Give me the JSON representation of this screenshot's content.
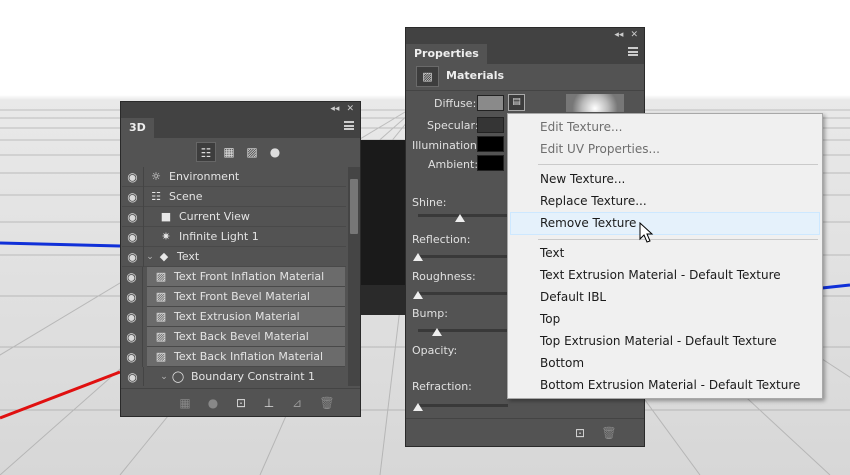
{
  "panel3d": {
    "tab": "3D",
    "layers": [
      {
        "label": "Environment",
        "icon": "environment-icon",
        "glyph": "☼",
        "depth": 0,
        "selected": false
      },
      {
        "label": "Scene",
        "icon": "scene-icon",
        "glyph": "☷",
        "depth": 0,
        "selected": false
      },
      {
        "label": "Current View",
        "icon": "camera-icon",
        "glyph": "■",
        "depth": 1,
        "selected": false
      },
      {
        "label": "Infinite Light 1",
        "icon": "light-icon",
        "glyph": "✷",
        "depth": 1,
        "selected": false
      },
      {
        "label": "Text",
        "icon": "mesh-icon",
        "glyph": "◆",
        "depth": 1,
        "selected": false
      },
      {
        "label": "Text Front Inflation Material",
        "icon": "material-icon",
        "glyph": "▨",
        "depth": 2,
        "selected": true
      },
      {
        "label": "Text Front Bevel Material",
        "icon": "material-icon",
        "glyph": "▨",
        "depth": 2,
        "selected": true
      },
      {
        "label": "Text Extrusion Material",
        "icon": "material-icon",
        "glyph": "▨",
        "depth": 2,
        "selected": true
      },
      {
        "label": "Text Back Bevel Material",
        "icon": "material-icon",
        "glyph": "▨",
        "depth": 2,
        "selected": true
      },
      {
        "label": "Text Back Inflation Material",
        "icon": "material-icon",
        "glyph": "▨",
        "depth": 2,
        "selected": true
      },
      {
        "label": "Boundary Constraint 1",
        "icon": "constraint-icon",
        "glyph": "◯",
        "depth": 2,
        "selected": false
      }
    ]
  },
  "properties": {
    "tab": "Properties",
    "section": "Materials",
    "labels": {
      "diffuse": "Diffuse:",
      "specular": "Specular:",
      "illumination": "Illumination:",
      "ambient": "Ambient:",
      "shine": "Shine:",
      "reflection": "Reflection:",
      "roughness": "Roughness:",
      "bump": "Bump:",
      "opacity": "Opacity:",
      "refraction": "Refraction:"
    },
    "colors": {
      "diffuse": "#8a8a8a",
      "specular": "#353535",
      "illumination": "#000000",
      "ambient": "#000000"
    }
  },
  "context_menu": {
    "items": [
      {
        "label": "Edit Texture...",
        "enabled": false
      },
      {
        "label": "Edit UV Properties...",
        "enabled": false
      },
      {
        "label": "New Texture...",
        "enabled": true
      },
      {
        "label": "Replace Texture...",
        "enabled": true
      },
      {
        "label": "Remove Texture",
        "enabled": true,
        "highlighted": true
      },
      {
        "label": "Text",
        "enabled": true
      },
      {
        "label": "Text Extrusion Material - Default Texture",
        "enabled": true
      },
      {
        "label": "Default IBL",
        "enabled": true
      },
      {
        "label": "Top",
        "enabled": true
      },
      {
        "label": "Top Extrusion Material - Default Texture",
        "enabled": true
      },
      {
        "label": "Bottom",
        "enabled": true
      },
      {
        "label": "Bottom Extrusion Material - Default Texture",
        "enabled": true
      }
    ]
  }
}
